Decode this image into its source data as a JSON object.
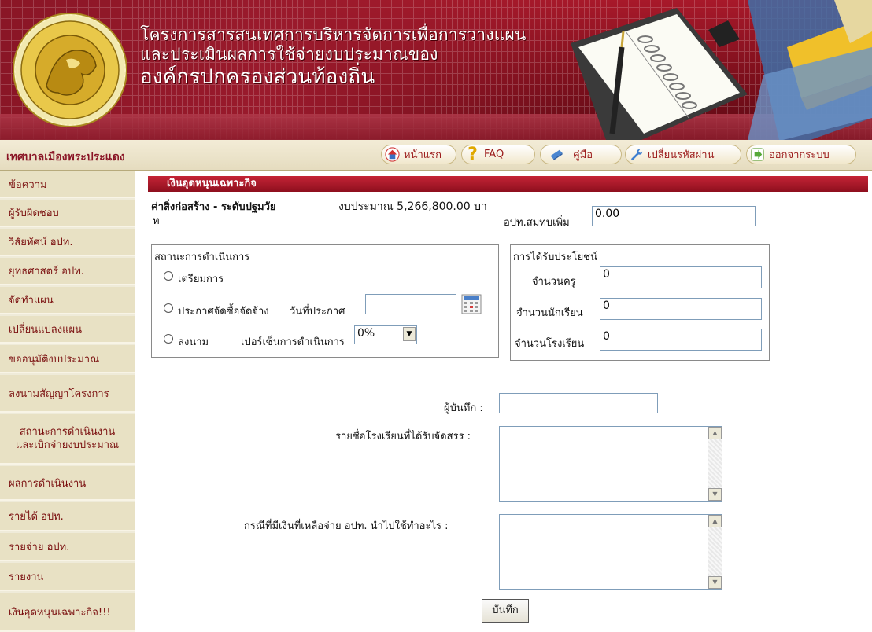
{
  "banner": {
    "line1": "โครงการสารสนเทศการบริหารจัดการเพื่อการวางแผน",
    "line2": "และประเมินผลการใช้จ่ายงบประมาณของ",
    "line3": "องค์กรปกครองส่วนท้องถิ่น"
  },
  "toolbar": {
    "org_name": "เทศบาลเมืองพระประแดง",
    "nav": [
      {
        "label": "หน้าแรก",
        "icon": "home-icon"
      },
      {
        "label": "FAQ",
        "icon": "question-icon"
      },
      {
        "label": "คู่มือ",
        "icon": "manual-icon"
      },
      {
        "label": "เปลี่ยนรหัสผ่าน",
        "icon": "wrench-icon"
      },
      {
        "label": "ออกจากระบบ",
        "icon": "logout-icon"
      }
    ]
  },
  "sidebar": {
    "items": [
      {
        "label": "ข้อความ"
      },
      {
        "label": "ผู้รับผิดชอบ"
      },
      {
        "label": "วิสัยทัศน์ อปท."
      },
      {
        "label": "ยุทธศาสตร์ อปท."
      },
      {
        "label": "จัดทำแผน"
      },
      {
        "label": "เปลี่ยนแปลงแผน"
      },
      {
        "label": "ขออนุมัติงบประมาณ"
      },
      {
        "label": "ลงนามสัญญาโครงการ"
      },
      {
        "label": "สถานะการดำเนินงาน",
        "label2": "และเบิกจ่ายงบประมาณ"
      },
      {
        "label": "ผลการดำเนินงาน"
      },
      {
        "label": "รายได้ อปท."
      },
      {
        "label": "รายจ่าย อปท."
      },
      {
        "label": "รายงาน"
      },
      {
        "label": "เงินอุดหนุนเฉพาะกิจ!!!"
      }
    ]
  },
  "main": {
    "section_title": "เงินอุดหนุนเฉพาะกิจ",
    "project_title": "ค่าสิ่งก่อสร้าง - ระดับปฐมวัย",
    "budget_line1": "งบประมาณ 5,266,800.00 บา",
    "budget_line2": "ท",
    "extra_label": "อปท.สมทบเพิ่ม",
    "extra_value": "0.00",
    "status": {
      "legend": "สถานะการดำเนินการ",
      "opt_prepare": "เตรียมการ",
      "opt_announce": "ประกาศจัดซื้อจัดจ้าง",
      "announce_date_label": "วันที่ประกาศ",
      "announce_date_value": "",
      "opt_sign": "ลงนาม",
      "percent_label": "เปอร์เซ็นการดำเนินการ",
      "percent_value": "0%"
    },
    "benefit": {
      "legend": "การได้รับประโยชน์",
      "teachers_label": "จำนวนครู",
      "teachers_value": "0",
      "students_label": "จำนวนนักเรียน",
      "students_value": "0",
      "schools_label": "จำนวนโรงเรียน",
      "schools_value": "0"
    },
    "recorder_label": "ผู้บันทึก :",
    "recorder_value": "",
    "schools_list_label": "รายชื่อโรงเรียนที่ได้รับจัดสรร :",
    "leftover_label": "กรณีที่มีเงินที่เหลือจ่าย อปท. นำไปใช้ทำอะไร :",
    "save_label": "บันทึก"
  },
  "colors": {
    "banner_red": "#8a1626",
    "accent_red": "#c42436",
    "sidebar_bg": "#e8e1c4",
    "link_text": "#7b1010"
  }
}
